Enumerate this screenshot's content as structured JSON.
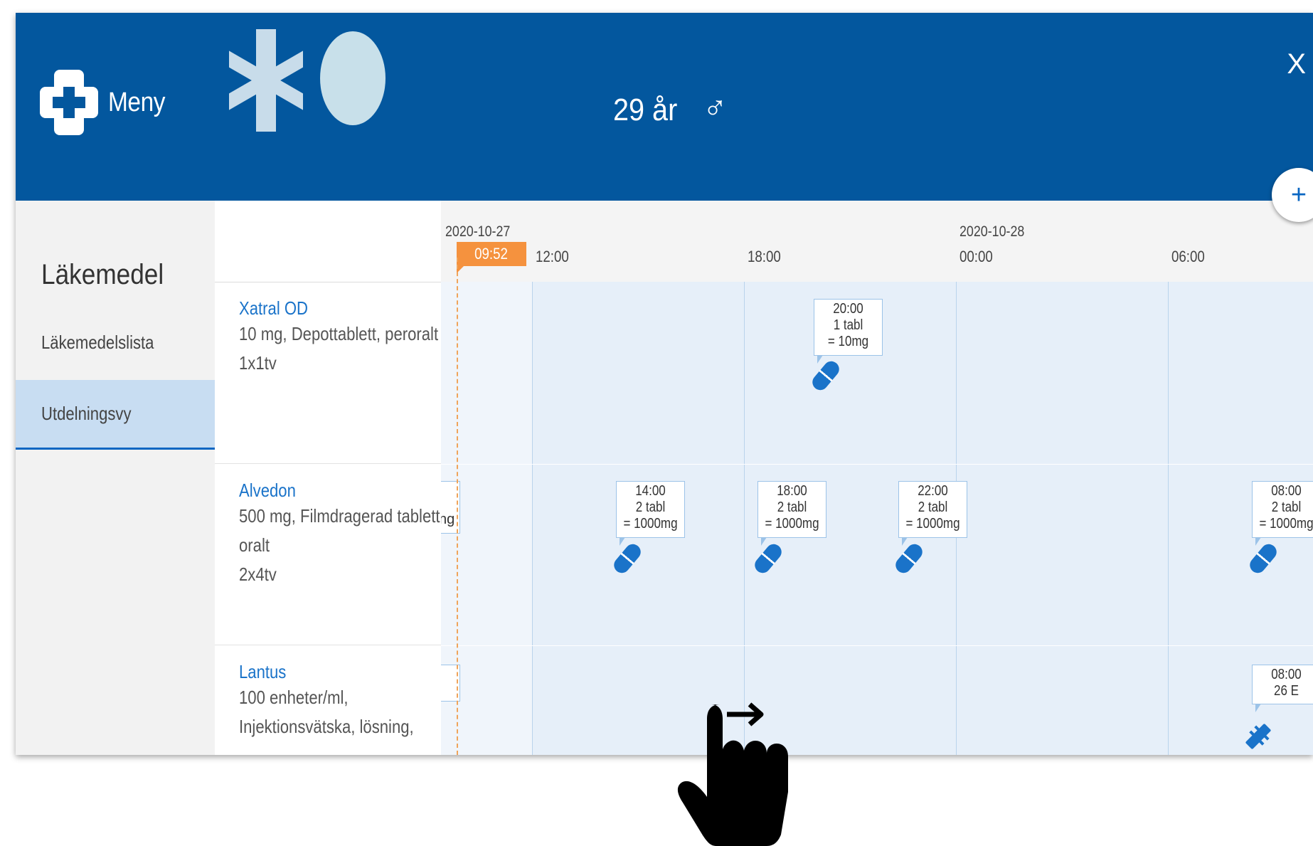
{
  "header": {
    "menu_label": "Meny",
    "patient_age": "29 år",
    "gender_symbol": "♂",
    "close_label": "X",
    "add_label": "+",
    "icons": [
      "plus-cross-icon",
      "star-of-life-icon",
      "avatar"
    ]
  },
  "sidebar": {
    "title": "Läkemedel",
    "items": [
      {
        "label": "Läkemedelslista",
        "selected": false
      },
      {
        "label": "Utdelningsvy",
        "selected": true
      }
    ]
  },
  "medications": [
    {
      "name": "Xatral OD",
      "desc": [
        "10 mg, Depottablett, peroralt",
        "1x1tv"
      ]
    },
    {
      "name": "Alvedon",
      "desc": [
        "500 mg, Filmdragerad tablett,",
        "oralt",
        "2x4tv"
      ]
    },
    {
      "name": "Lantus",
      "desc": [
        "100 enheter/ml,",
        "Injektionsvätska, lösning,"
      ]
    }
  ],
  "timeline": {
    "now_badge": "09:52",
    "dates": [
      {
        "label": "2020-10-27"
      },
      {
        "label": "2020-10-28"
      }
    ],
    "times": [
      "12:00",
      "18:00",
      "00:00",
      "06:00"
    ],
    "doses": [
      {
        "row": 0,
        "lines": [
          "20:00",
          "1 tabl",
          "= 10mg"
        ],
        "type": "pill"
      },
      {
        "row": 1,
        "lines": [
          "14:00",
          "2 tabl",
          "= 1000mg"
        ],
        "type": "pill"
      },
      {
        "row": 1,
        "lines": [
          "18:00",
          "2 tabl",
          "= 1000mg"
        ],
        "type": "pill"
      },
      {
        "row": 1,
        "lines": [
          "22:00",
          "2 tabl",
          "= 1000mg"
        ],
        "type": "pill"
      },
      {
        "row": 1,
        "lines": [
          "08:00",
          "2 tabl",
          "= 1000mg"
        ],
        "type": "pill"
      },
      {
        "row": 2,
        "lines": [
          "08:00",
          "26 E"
        ],
        "type": "syringe"
      }
    ],
    "partial_text": "ng"
  },
  "colors": {
    "header_bg": "#03579e",
    "accent": "#1a73c9",
    "now_badge": "#f5923e",
    "selected_bg": "#c8ddf2"
  }
}
